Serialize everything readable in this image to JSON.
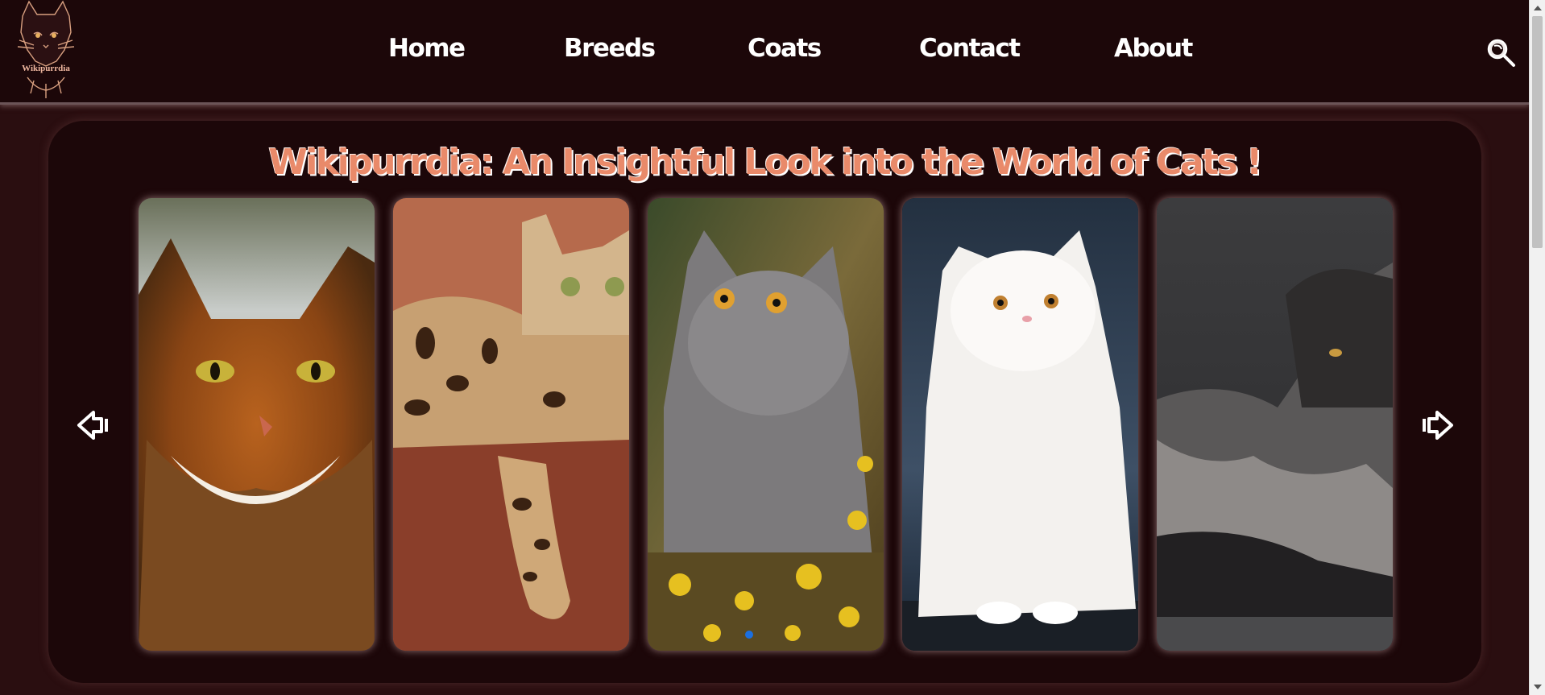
{
  "brand": {
    "logo_text": "Wikipurrdia",
    "logo_icon": "cat-face-logo"
  },
  "nav": {
    "items": [
      {
        "label": "Home"
      },
      {
        "label": "Breeds"
      },
      {
        "label": "Coats"
      },
      {
        "label": "Contact"
      },
      {
        "label": "About"
      }
    ],
    "search_icon": "search-icon"
  },
  "hero": {
    "title": "Wikipurrdia: An Insightful Look into the World of Cats !"
  },
  "carousel": {
    "prev_icon": "arrow-left-icon",
    "next_icon": "arrow-right-icon",
    "cards": [
      {
        "subject": "ruddy tabby cat"
      },
      {
        "subject": "spotted cat on sofa"
      },
      {
        "subject": "gray cat among yellow flowers"
      },
      {
        "subject": "white longhair cat"
      },
      {
        "subject": "smoke longhair cat"
      }
    ],
    "active_dot_color": "#1b6fe0"
  },
  "colors": {
    "header_bg": "#1c0709",
    "page_bg": "#2a0e10",
    "title_color": "#e98a6a",
    "nav_text": "#ffffff"
  }
}
